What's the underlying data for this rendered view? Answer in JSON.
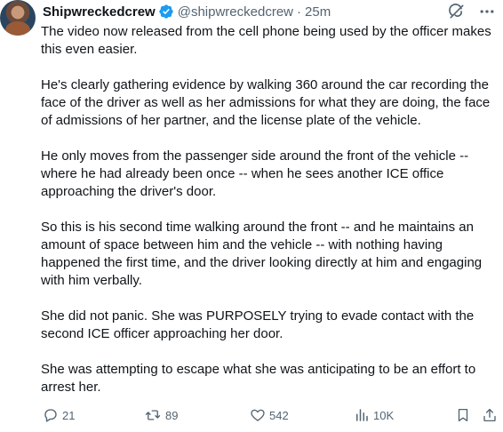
{
  "author": {
    "display_name": "Shipwreckedcrew",
    "handle": "@shipwreckedcrew",
    "separator": "·",
    "timestamp": "25m",
    "verified": true
  },
  "tweet": {
    "paragraphs": [
      "The video now released from the cell phone being used by the officer makes this even easier.",
      "He's clearly gathering evidence by walking 360 around the car recording the face of the driver as well as her admissions for what they are doing, the face of admissions of her partner, and the license plate of the vehicle.",
      "He only moves from the passenger side around the front of the vehicle -- where he had already been once -- when he sees another ICE office approaching the driver's door.",
      "So this is his second time walking around the front -- and he maintains an amount of space between him and the vehicle -- with nothing having happened the first time, and the driver looking directly at him and engaging with him verbally.",
      "She did not panic.  She was PURPOSELY trying to evade contact with the second ICE officer approaching her door.",
      "She was attempting to escape what she was anticipating to be an effort to arrest her."
    ]
  },
  "actions": {
    "replies": "21",
    "reposts": "89",
    "likes": "542",
    "views": "10K"
  },
  "icons": {
    "verified": "verified-badge-icon",
    "grok": "grok-icon",
    "more": "more-icon",
    "reply": "reply-icon",
    "repost": "repost-icon",
    "like": "like-icon",
    "views": "views-icon",
    "bookmark": "bookmark-icon",
    "share": "share-icon"
  },
  "colors": {
    "text": "#0f1419",
    "muted": "#536471",
    "verified": "#1d9bf0"
  }
}
